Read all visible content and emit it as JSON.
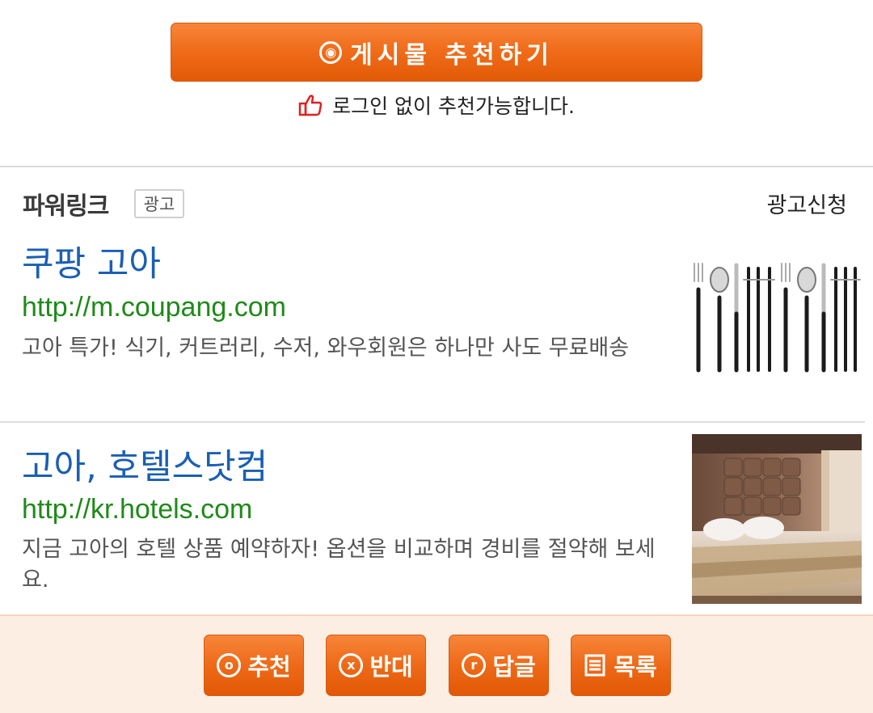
{
  "recommend": {
    "button_icon": "◎",
    "button_label": "게시물  추천하기",
    "note": "로그인 없이 추천가능합니다.",
    "note_icon": "thumbs-up-icon"
  },
  "powerlink": {
    "title": "파워링크",
    "badge": "광고",
    "apply_label": "광고신청",
    "ads": [
      {
        "title": "쿠팡 고아",
        "url": "http://m.coupang.com",
        "description": "고아 특가! 식기, 커트러리, 수저, 와우회원은 하나만 사도 무료배송",
        "image": "cutlery-image"
      },
      {
        "title": "고아, 호텔스닷컴",
        "url": "http://kr.hotels.com",
        "description": "지금 고아의 호텔 상품 예약하자! 옵션을 비교하며 경비를 절약해 보세요.",
        "image": "hotel-room-image"
      }
    ]
  },
  "toolbar": {
    "buttons": [
      {
        "icon": "o",
        "label": "추천"
      },
      {
        "icon": "x",
        "label": "반대"
      },
      {
        "icon": "r",
        "label": "답글"
      },
      {
        "icon": "list-icon",
        "label": "목록"
      }
    ]
  },
  "colors": {
    "accent_orange": "#f06d1b",
    "link_blue": "#1a5fb4",
    "url_green": "#1f8a19",
    "toolbar_bg": "#fdeee3"
  }
}
